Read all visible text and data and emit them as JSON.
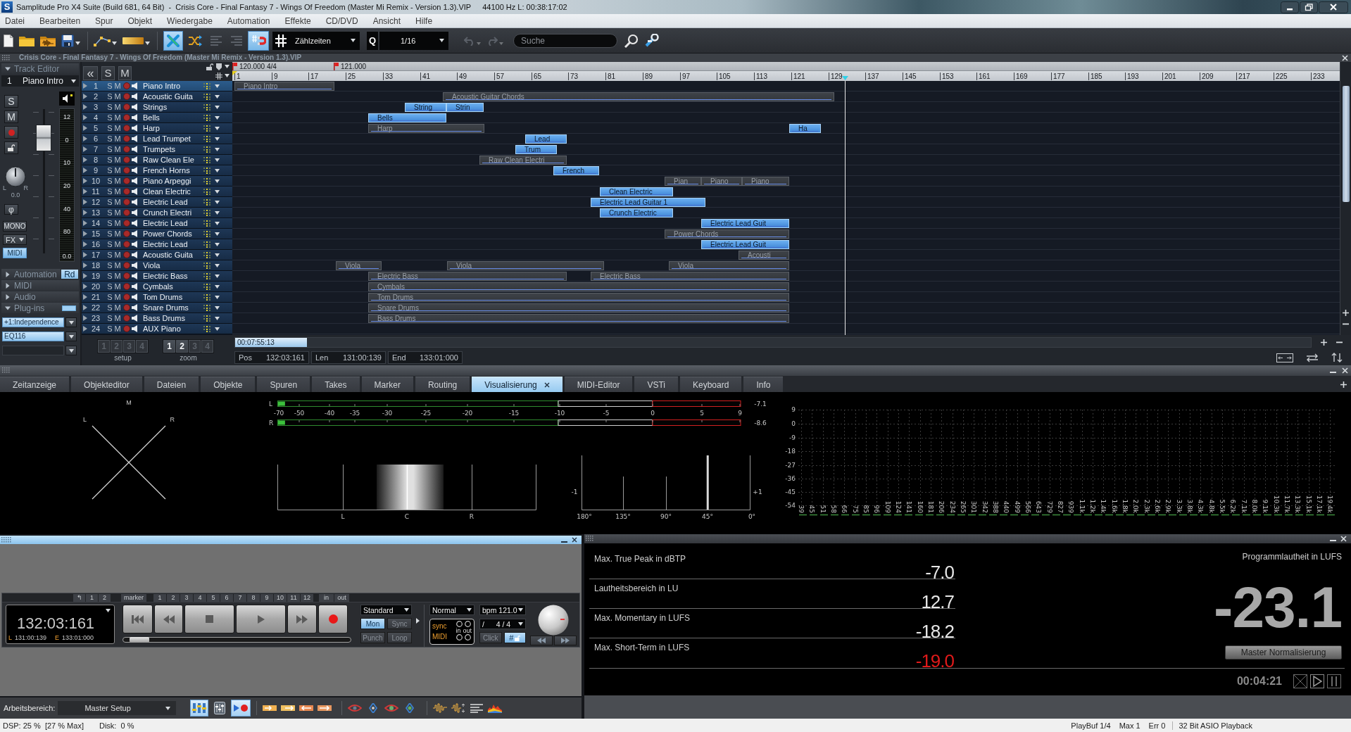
{
  "window": {
    "logo": "S",
    "title": "Samplitude Pro X4 Suite (Build 681, 64 Bit)  -  Crisis Core - Final Fantasy 7 - Wings Of Freedom (Master Mi Remix - Version 1.3).VIP",
    "info": "44100 Hz L: 00:38:17:02"
  },
  "menu": [
    "Datei",
    "Bearbeiten",
    "Spur",
    "Objekt",
    "Wiedergabe",
    "Automation",
    "Effekte",
    "CD/DVD",
    "Ansicht",
    "Hilfe"
  ],
  "toolbar": {
    "tools": [
      {
        "selected": true
      },
      {
        "selected": false
      },
      {
        "selected": false
      },
      {
        "selected": false
      },
      {
        "selected": true
      }
    ],
    "snap_mode": "Zählzeiten",
    "quantize_label": "Q",
    "quantize": "1/16",
    "search": {
      "placeholder": "Suche"
    }
  },
  "project": {
    "file": "Crisis Core - Final Fantasy 7 - Wings Of Freedom (Master Mi Remix - Version 1.3).VIP"
  },
  "track_editor": {
    "title": "Track Editor",
    "expanded": true,
    "track_number": "1",
    "track_name": "Piano Intro",
    "solo": "S",
    "mute": "M",
    "fader": {
      "level": 0.87
    },
    "pan": {
      "left": "L",
      "right": "R",
      "value": "0.0"
    },
    "phase": "φ",
    "mono": "MONO",
    "fx": "FX",
    "midi": {
      "label": "MIDI",
      "selected": true
    },
    "meter_scale": [
      "12",
      "0",
      "10",
      "20",
      "40",
      "80"
    ],
    "meter_value": "0.0",
    "sections": [
      {
        "label": "Automation",
        "expanded": false,
        "mode": {
          "label": "Rd",
          "selected": true
        }
      },
      {
        "label": "MIDI",
        "expanded": false
      },
      {
        "label": "Audio",
        "expanded": false
      },
      {
        "label": "Plug-ins",
        "expanded": true,
        "on": true
      }
    ],
    "plugins": [
      "+1:Independence",
      "EQ116"
    ]
  },
  "track_list": {
    "collapse": "«",
    "solo": "S",
    "mute": "M",
    "tracks": [
      {
        "number": "1",
        "name": "Piano Intro",
        "solo": "S",
        "mute": "M",
        "selected": true,
        "clips": [
          {
            "label": "Piano Intro",
            "selected": false
          }
        ]
      },
      {
        "number": "2",
        "name": "Acoustic Guita",
        "solo": "S",
        "mute": "M",
        "selected": false,
        "clips": [
          {
            "label": "Acoustic Guitar Chords",
            "selected": false
          }
        ]
      },
      {
        "number": "3",
        "name": "Strings",
        "solo": "S",
        "mute": "M",
        "selected": false,
        "clips": [
          {
            "label": "String",
            "selected": true
          },
          {
            "label": "Strin",
            "selected": true
          }
        ]
      },
      {
        "number": "4",
        "name": "Bells",
        "solo": "S",
        "mute": "M",
        "selected": false,
        "clips": [
          {
            "label": "Bells",
            "selected": true
          }
        ]
      },
      {
        "number": "5",
        "name": "Harp",
        "solo": "S",
        "mute": "M",
        "selected": false,
        "clips": [
          {
            "label": "Harp",
            "selected": false
          },
          {
            "label": "Ha",
            "selected": true
          }
        ]
      },
      {
        "number": "6",
        "name": "Lead Trumpet",
        "solo": "S",
        "mute": "M",
        "selected": false,
        "clips": [
          {
            "label": "Lead",
            "selected": true
          }
        ]
      },
      {
        "number": "7",
        "name": "Trumpets",
        "solo": "S",
        "mute": "M",
        "selected": false,
        "clips": [
          {
            "label": "Trum",
            "selected": true
          }
        ]
      },
      {
        "number": "8",
        "name": "Raw Clean Ele",
        "solo": "S",
        "mute": "M",
        "selected": false,
        "clips": [
          {
            "label": "Raw Clean Electri",
            "selected": false
          }
        ]
      },
      {
        "number": "9",
        "name": "French Horns",
        "solo": "S",
        "mute": "M",
        "selected": false,
        "clips": [
          {
            "label": "French",
            "selected": true
          }
        ]
      },
      {
        "number": "10",
        "name": "Piano Arpeggi",
        "solo": "S",
        "mute": "M",
        "selected": false,
        "clips": [
          {
            "label": "Pian",
            "selected": false
          },
          {
            "label": "Piano",
            "selected": false
          },
          {
            "label": "Piano",
            "selected": false
          }
        ]
      },
      {
        "number": "11",
        "name": "Clean Electric",
        "solo": "S",
        "mute": "M",
        "selected": false,
        "clips": [
          {
            "label": "Clean Electric",
            "selected": true
          }
        ]
      },
      {
        "number": "12",
        "name": "Electric Lead",
        "solo": "S",
        "mute": "M",
        "selected": false,
        "clips": [
          {
            "label": "Electric Lead Guitar 1",
            "selected": true
          }
        ]
      },
      {
        "number": "13",
        "name": "Crunch Electri",
        "solo": "S",
        "mute": "M",
        "selected": false,
        "clips": [
          {
            "label": "Crunch Electric",
            "selected": true
          }
        ]
      },
      {
        "number": "14",
        "name": "Electric Lead",
        "solo": "S",
        "mute": "M",
        "selected": false,
        "clips": [
          {
            "label": "Electric Lead Guit",
            "selected": true
          }
        ]
      },
      {
        "number": "15",
        "name": "Power Chords",
        "solo": "S",
        "mute": "M",
        "selected": false,
        "clips": [
          {
            "label": "Power Chords",
            "selected": false
          }
        ]
      },
      {
        "number": "16",
        "name": "Electric Lead",
        "solo": "S",
        "mute": "M",
        "selected": false,
        "clips": [
          {
            "label": "Electric Lead Guit",
            "selected": true
          }
        ]
      },
      {
        "number": "17",
        "name": "Acoustic Guita",
        "solo": "S",
        "mute": "M",
        "selected": false,
        "clips": [
          {
            "label": "Acousti",
            "selected": false
          }
        ]
      },
      {
        "number": "18",
        "name": "Viola",
        "solo": "S",
        "mute": "M",
        "selected": false,
        "clips": [
          {
            "label": "Viola",
            "selected": false
          },
          {
            "label": "Viola",
            "selected": false
          },
          {
            "label": "Viola",
            "selected": false
          }
        ]
      },
      {
        "number": "19",
        "name": "Electric Bass",
        "solo": "S",
        "mute": "M",
        "selected": false,
        "clips": [
          {
            "label": "Electric Bass",
            "selected": false
          },
          {
            "label": "Electric Bass",
            "selected": false
          }
        ]
      },
      {
        "number": "20",
        "name": "Cymbals",
        "solo": "S",
        "mute": "M",
        "selected": false,
        "clips": [
          {
            "label": "Cymbals",
            "selected": false
          }
        ]
      },
      {
        "number": "21",
        "name": "Tom Drums",
        "solo": "S",
        "mute": "M",
        "selected": false,
        "clips": [
          {
            "label": "Tom Drums",
            "selected": false
          }
        ]
      },
      {
        "number": "22",
        "name": "Snare Drums",
        "solo": "S",
        "mute": "M",
        "selected": false,
        "clips": [
          {
            "label": "Snare Drums",
            "selected": false
          }
        ]
      },
      {
        "number": "23",
        "name": "Bass Drums",
        "solo": "S",
        "mute": "M",
        "selected": false,
        "clips": [
          {
            "label": "Bass Drums",
            "selected": false
          }
        ]
      },
      {
        "number": "24",
        "name": "AUX Piano",
        "solo": "S",
        "mute": "M",
        "selected": false
      }
    ]
  },
  "ruler": {
    "markers": [
      {
        "label": "120.000 4/4"
      },
      {
        "label": "121.000"
      }
    ],
    "bars": [
      "1",
      "9",
      "17",
      "25",
      "33",
      "41",
      "49",
      "57",
      "65",
      "73",
      "81",
      "89",
      "97",
      "105",
      "113",
      "121",
      "129",
      "137",
      "145",
      "153",
      "161",
      "169",
      "177",
      "185",
      "193",
      "201",
      "209",
      "217",
      "225",
      "233"
    ]
  },
  "scroll_time": "00:07:55:13",
  "position": [
    {
      "label": "Pos",
      "value": "132:03:161"
    },
    {
      "label": "Len",
      "value": "131:00:139"
    },
    {
      "label": "End",
      "value": "133:01:000"
    }
  ],
  "setup": {
    "label": "setup",
    "buttons": [
      {
        "label": "1",
        "disabled": true
      },
      {
        "label": "2",
        "disabled": true
      },
      {
        "label": "3",
        "disabled": true
      },
      {
        "label": "4",
        "disabled": true
      }
    ]
  },
  "zoom": {
    "label": "zoom",
    "buttons": [
      {
        "label": "1",
        "disabled": false
      },
      {
        "label": "2",
        "disabled": false
      },
      {
        "label": "3",
        "disabled": true
      },
      {
        "label": "4",
        "disabled": true
      }
    ]
  },
  "tabs": [
    {
      "label": "Zeitanzeige",
      "selected": false
    },
    {
      "label": "Objekteditor",
      "selected": false
    },
    {
      "label": "Dateien",
      "selected": false
    },
    {
      "label": "Objekte",
      "selected": false
    },
    {
      "label": "Spuren",
      "selected": false
    },
    {
      "label": "Takes",
      "selected": false
    },
    {
      "label": "Marker",
      "selected": false
    },
    {
      "label": "Routing",
      "selected": false
    },
    {
      "label": "Visualisierung",
      "selected": true
    },
    {
      "label": "MIDI-Editor",
      "selected": false
    },
    {
      "label": "VSTi",
      "selected": false
    },
    {
      "label": "Keyboard",
      "selected": false
    },
    {
      "label": "Info",
      "selected": false
    }
  ],
  "visualization": {
    "goniometer": {
      "mid": "M",
      "left": "L",
      "right": "R"
    },
    "level_meter": {
      "channels": [
        {
          "label": "L",
          "level": 0.015,
          "peak": "-7.1"
        },
        {
          "label": "R",
          "level": 0.015,
          "peak": "-8.6"
        }
      ],
      "scale": [
        "-70",
        "-50",
        "-40",
        "-35",
        "-30",
        "-25",
        "-20",
        "-15",
        "-10",
        "-5",
        "0",
        "5",
        "9"
      ]
    },
    "panorama": {
      "labels": [
        "L",
        "C",
        "R"
      ]
    },
    "correlation": {
      "minus": "-1",
      "plus": "+1",
      "scale": [
        "180°",
        "135°",
        "90°",
        "45°",
        "0°"
      ],
      "level": 0.75
    },
    "spectrum": {
      "db_scale": [
        "9",
        "0",
        "-9",
        "-18",
        "-27",
        "-36",
        "-45",
        "-54"
      ],
      "frequencies": [
        "39",
        "45",
        "51",
        "58",
        "66",
        "75",
        "85",
        "96",
        "109",
        "124",
        "141",
        "160",
        "181",
        "206",
        "234",
        "265",
        "301",
        "342",
        "388",
        "440",
        "499",
        "566",
        "643",
        "729",
        "827",
        "939",
        "1.1k",
        "1.2k",
        "1.4k",
        "1.6k",
        "1.8k",
        "2.0k",
        "2.3k",
        "2.6k",
        "2.9k",
        "3.3k",
        "3.8k",
        "4.3k",
        "4.8k",
        "5.5k",
        "6.2k",
        "7.1k",
        "8.0k",
        "9.1k",
        "10.3k",
        "11.7k",
        "13.3k",
        "15.1k",
        "17.1k",
        "19.4k"
      ]
    }
  },
  "transport": {
    "undo": "↰",
    "locate": [
      "1",
      "2"
    ],
    "marker_label": "marker",
    "markers": [
      "1",
      "2",
      "3",
      "4",
      "5",
      "6",
      "7",
      "8",
      "9",
      "10",
      "11",
      "12"
    ],
    "in": "in",
    "out": "out",
    "time": "132:03:161",
    "left_label": "L",
    "left": "131:00:139",
    "end_label": "E",
    "end": "133:01:000",
    "position": {
      "level": 0.03
    },
    "mode": "Standard",
    "toggles": [
      {
        "label": "Mon",
        "selected": true
      },
      {
        "label": "Sync",
        "selected": false
      },
      {
        "label": "Punch",
        "selected": false
      },
      {
        "label": "Loop",
        "selected": false
      }
    ],
    "speed": "Normal",
    "bpm": "bpm 121.0",
    "sync": {
      "sync_label": "sync",
      "midi_label": "MIDI",
      "in_label": "in",
      "out_label": "out"
    },
    "signature_prefix": "/",
    "signature": "4 / 4",
    "click": {
      "label": "Click",
      "selected": false
    },
    "grid": {
      "label": "#",
      "selected": true
    }
  },
  "loudness": {
    "rows": [
      {
        "label": "Max. True Peak in dBTP",
        "value": "-7.0",
        "exceeded": false
      },
      {
        "label": "Lautheitsbereich in LU",
        "value": "12.7",
        "exceeded": false
      },
      {
        "label": "Max. Momentary in LUFS",
        "value": "-18.2",
        "exceeded": false
      },
      {
        "label": "Max. Short-Term in LUFS",
        "value": "-19.0",
        "exceeded": true
      }
    ],
    "program_label": "Programmlautheit in LUFS",
    "program_value": "-23.1",
    "normalize": "Master Normalisierung",
    "elapsed": "00:04:21"
  },
  "workspace": {
    "label": "Arbeitsbereich:",
    "value": "Master Setup",
    "views": [
      {
        "selected": true
      },
      {
        "selected": false
      },
      {
        "selected": true
      }
    ]
  },
  "status_bar": {
    "dsp": "DSP: 25 %  [27 % Max]",
    "disk": "Disk:  0 %",
    "playback": [
      "PlayBuf 1/4",
      "Max 1",
      "Err 0"
    ],
    "driver": "32 Bit ASIO Playback"
  }
}
